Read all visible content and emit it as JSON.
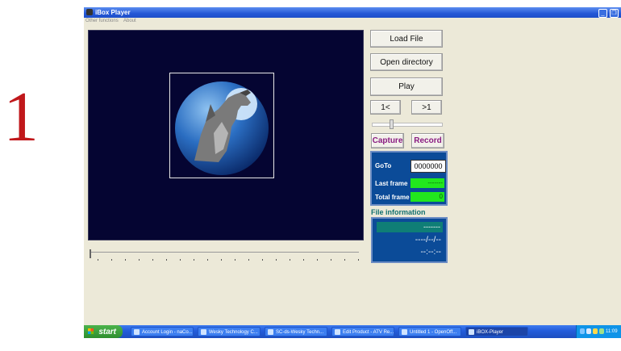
{
  "side_number": "1",
  "window": {
    "title": "iBox Player",
    "menu": [
      "Other functions",
      "About"
    ]
  },
  "controls": {
    "load_file": "Load File",
    "open_directory": "Open directory",
    "play": "Play",
    "prev_frame": "1<",
    "next_frame": ">1",
    "capture": "Capture",
    "record": "Record"
  },
  "goto_panel": {
    "goto_label": "GoTo",
    "goto_value": "0000000",
    "last_frame_label": "Last frame",
    "last_frame_value": "-------",
    "total_frame_label": "Total frame",
    "total_frame_value": "0"
  },
  "file_info": {
    "title": "File information",
    "line1": "-------",
    "date": "----/--/--",
    "time": "--:--:--"
  },
  "taskbar": {
    "start": "start",
    "items": [
      "Account Login - naCo...",
      "Wesky Technology C...",
      "SC-ds-Wesky Techn...",
      "Edit Product - ATV Re...",
      "Untitled 1 - OpenOff...",
      "iBOX-Player"
    ],
    "clock": "11:09 PM"
  },
  "colors": {
    "video_bg": "#050532",
    "panel_blue": "#0b4b98",
    "green_value": "#22e61e",
    "accent_purple": "#8a1c82",
    "taskbar_blue": "#245edc"
  }
}
